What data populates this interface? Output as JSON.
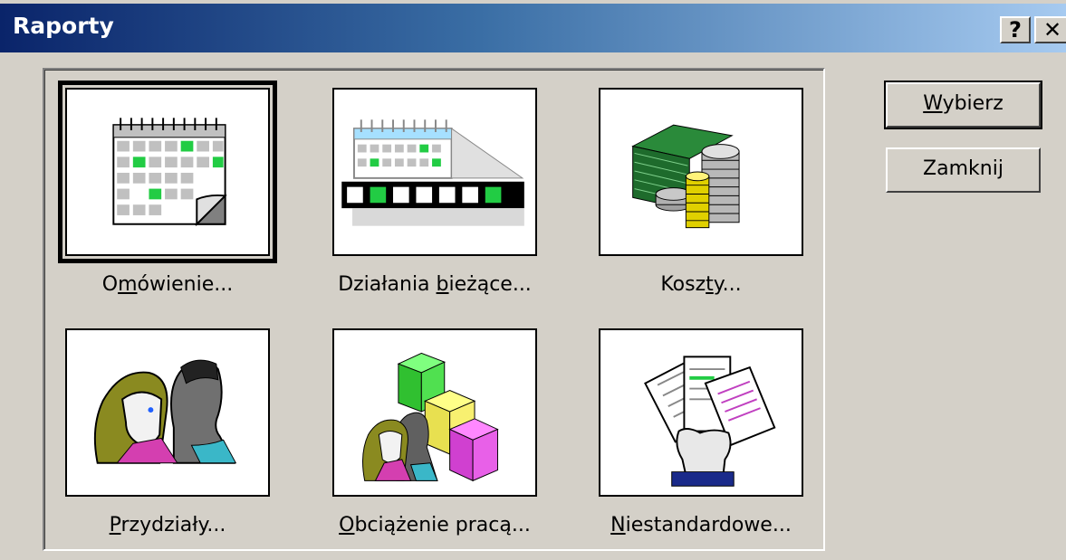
{
  "window": {
    "title": "Raporty",
    "help_label": "?",
    "close_label": "✕"
  },
  "tiles": [
    {
      "label_pre": "O",
      "label_u": "m",
      "label_post": "ówienie...",
      "icon": "calendar-month-icon"
    },
    {
      "label_pre": "Działania ",
      "label_u": "b",
      "label_post": "ieżące...",
      "icon": "calendar-timeline-icon"
    },
    {
      "label_pre": "Kosz",
      "label_u": "t",
      "label_post": "y...",
      "icon": "money-coins-icon"
    },
    {
      "label_pre": "",
      "label_u": "P",
      "label_post": "rzydziały...",
      "icon": "people-icon"
    },
    {
      "label_pre": "",
      "label_u": "O",
      "label_post": "bciążenie pracą...",
      "icon": "workload-blocks-icon"
    },
    {
      "label_pre": "",
      "label_u": "N",
      "label_post": "iestandardowe...",
      "icon": "custom-report-hand-icon"
    }
  ],
  "buttons": {
    "select": {
      "pre": "",
      "u": "W",
      "post": "ybierz"
    },
    "close": {
      "label": "Zamknij"
    }
  },
  "colors": {
    "accent_green": "#22cc44",
    "title_start": "#0a246a",
    "title_end": "#a6caf0"
  }
}
